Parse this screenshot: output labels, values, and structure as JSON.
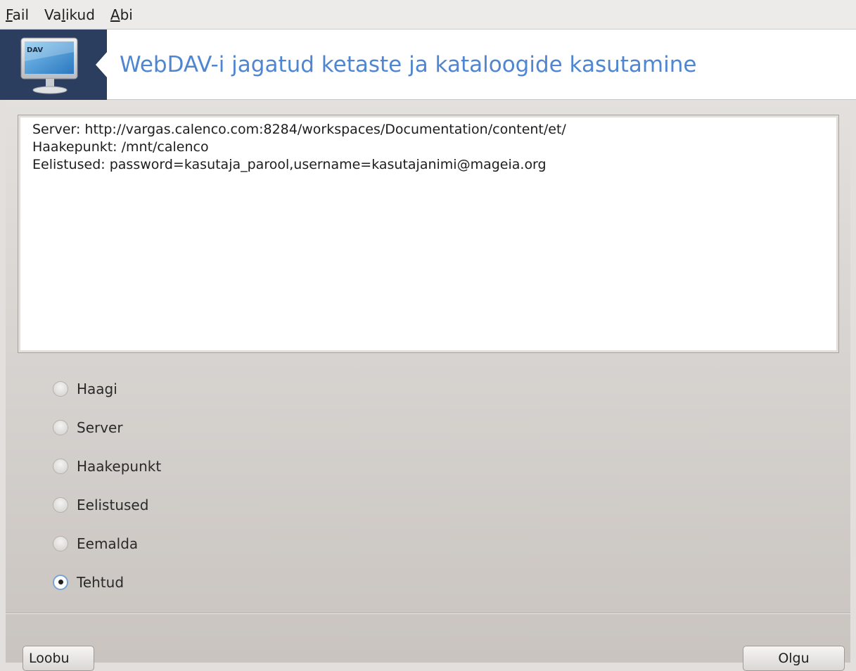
{
  "menubar": {
    "items": [
      {
        "mnemonic": "F",
        "rest": "ail"
      },
      {
        "prefix": "Va",
        "mnemonic": "l",
        "rest": "ikud"
      },
      {
        "mnemonic": "A",
        "rest": "bi"
      }
    ]
  },
  "header": {
    "icon": "webdav-monitor-icon",
    "icon_text": "DAV",
    "title": "WebDAV-i jagatud ketaste ja kataloogide kasutamine"
  },
  "info": {
    "lines": [
      "Server: http://vargas.calenco.com:8284/workspaces/Documentation/content/et/",
      "Haakepunkt: /mnt/calenco",
      "Eelistused: password=kasutaja_parool,username=kasutajanimi@mageia.org"
    ]
  },
  "options": [
    {
      "label": "Haagi",
      "checked": false
    },
    {
      "label": "Server",
      "checked": false
    },
    {
      "label": "Haakepunkt",
      "checked": false
    },
    {
      "label": "Eelistused",
      "checked": false
    },
    {
      "label": "Eemalda",
      "checked": false
    },
    {
      "label": "Tehtud",
      "checked": true
    }
  ],
  "buttons": {
    "cancel": "Loobu",
    "ok": "Olgu"
  },
  "colors": {
    "title": "#4f86d1",
    "icon_box": "#2b3e5f",
    "radio_checked_border": "#78a4d8"
  }
}
